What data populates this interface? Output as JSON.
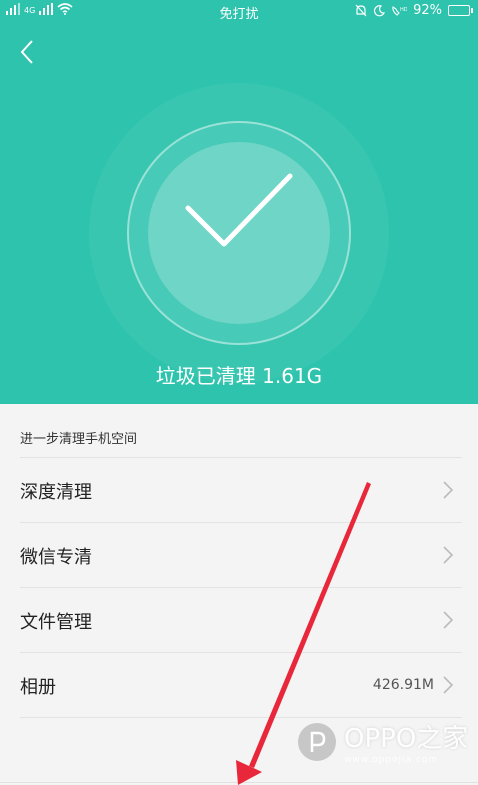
{
  "status_bar": {
    "signal_left": "4G",
    "center_text": "免打扰",
    "battery_percent": "92%"
  },
  "result": {
    "cleaned_text": "垃圾已清理 1.61G"
  },
  "list": {
    "section_header": "进一步清理手机空间",
    "items": [
      {
        "label": "深度清理",
        "value": ""
      },
      {
        "label": "微信专清",
        "value": ""
      },
      {
        "label": "文件管理",
        "value": ""
      },
      {
        "label": "相册",
        "value": "426.91M"
      }
    ]
  },
  "watermark": {
    "text": "OPPO之家",
    "sub": "www.oppojia.com"
  },
  "colors": {
    "accent": "#2ec3ad",
    "arrow": "#e8283a"
  }
}
